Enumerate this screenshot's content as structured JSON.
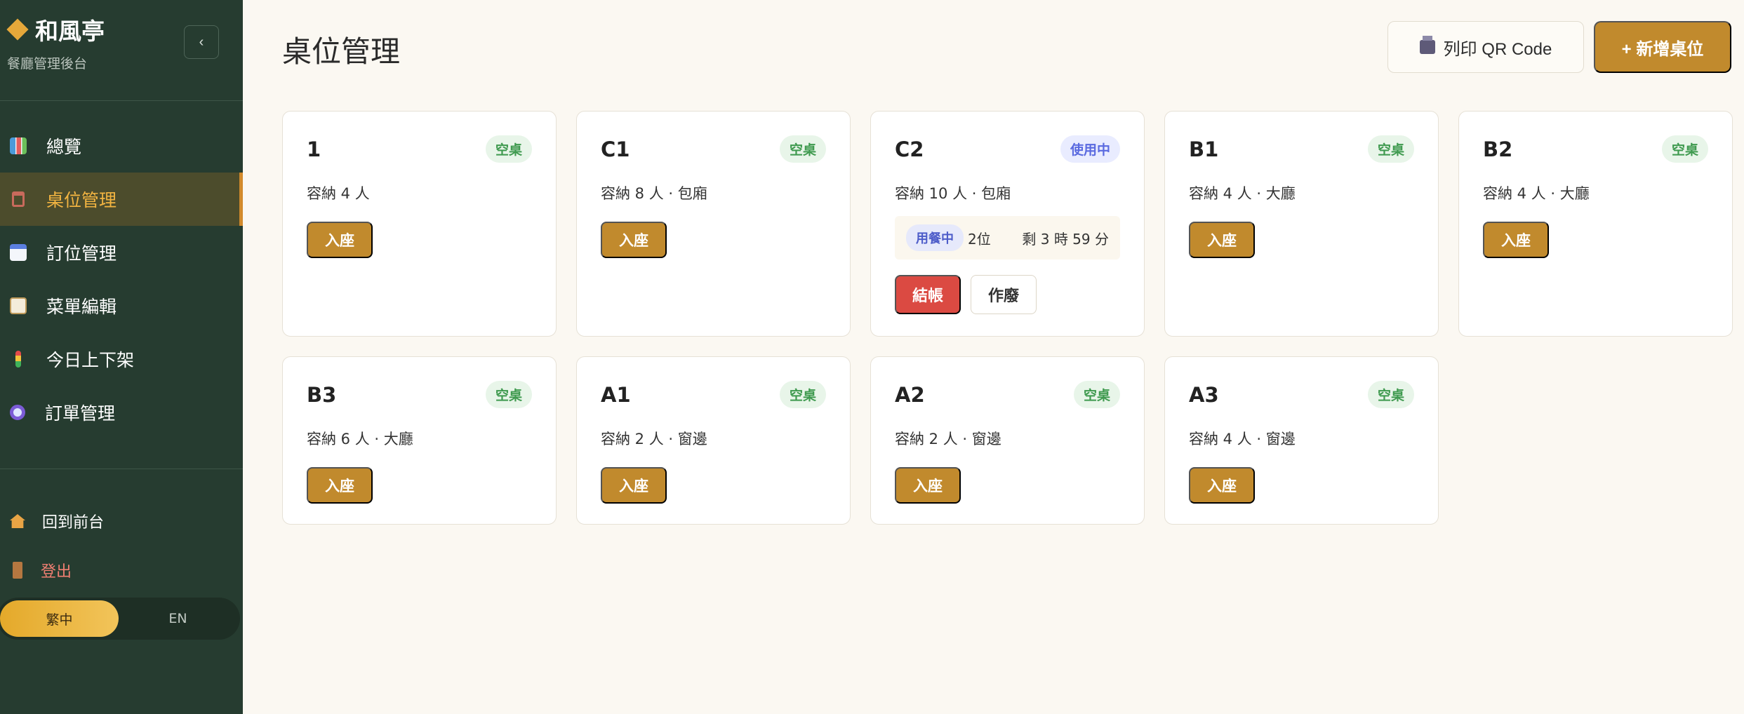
{
  "sidebar": {
    "brand_title": "和風亭",
    "brand_subtitle": "餐廳管理後台",
    "collapse_label": "‹",
    "nav": [
      {
        "label": "總覽",
        "icon": "chart-icon"
      },
      {
        "label": "桌位管理",
        "icon": "chair-icon",
        "active": true
      },
      {
        "label": "訂位管理",
        "icon": "calendar-icon"
      },
      {
        "label": "菜單編輯",
        "icon": "clipboard-icon"
      },
      {
        "label": "今日上下架",
        "icon": "traffic-light-icon"
      },
      {
        "label": "訂單管理",
        "icon": "magnifier-icon"
      }
    ],
    "bottom": {
      "home_label": "回到前台",
      "logout_label": "登出"
    },
    "lang": {
      "zh": "繁中",
      "en": "EN",
      "selected": "繁中"
    }
  },
  "header": {
    "title": "桌位管理",
    "print_label": "列印 QR Code",
    "add_label": "+ 新增桌位"
  },
  "tables": [
    {
      "name": "1",
      "status": "空桌",
      "capacity": "容納 4 人",
      "seat_label": "入座"
    },
    {
      "name": "C1",
      "status": "空桌",
      "capacity": "容納 8 人 · 包廂",
      "seat_label": "入座"
    },
    {
      "name": "C2",
      "status": "使用中",
      "capacity": "容納 10 人 · 包廂",
      "occupy_tag": "用餐中",
      "guests": "2位",
      "remaining": "剩 3 時 59 分",
      "checkout_label": "結帳",
      "void_label": "作廢"
    },
    {
      "name": "B1",
      "status": "空桌",
      "capacity": "容納 4 人 · 大廳",
      "seat_label": "入座"
    },
    {
      "name": "B2",
      "status": "空桌",
      "capacity": "容納 4 人 · 大廳",
      "seat_label": "入座"
    },
    {
      "name": "B3",
      "status": "空桌",
      "capacity": "容納 6 人 · 大廳",
      "seat_label": "入座"
    },
    {
      "name": "A1",
      "status": "空桌",
      "capacity": "容納 2 人 · 窗邊",
      "seat_label": "入座"
    },
    {
      "name": "A2",
      "status": "空桌",
      "capacity": "容納 2 人 · 窗邊",
      "seat_label": "入座"
    },
    {
      "name": "A3",
      "status": "空桌",
      "capacity": "容納 4 人 · 窗邊",
      "seat_label": "入座"
    }
  ],
  "colors": {
    "sidebar_bg": "#263c30",
    "accent": "#c18a2d",
    "free_badge": "#3f9a4f",
    "busy_badge": "#5a6ae0",
    "checkout": "#db4a42"
  }
}
